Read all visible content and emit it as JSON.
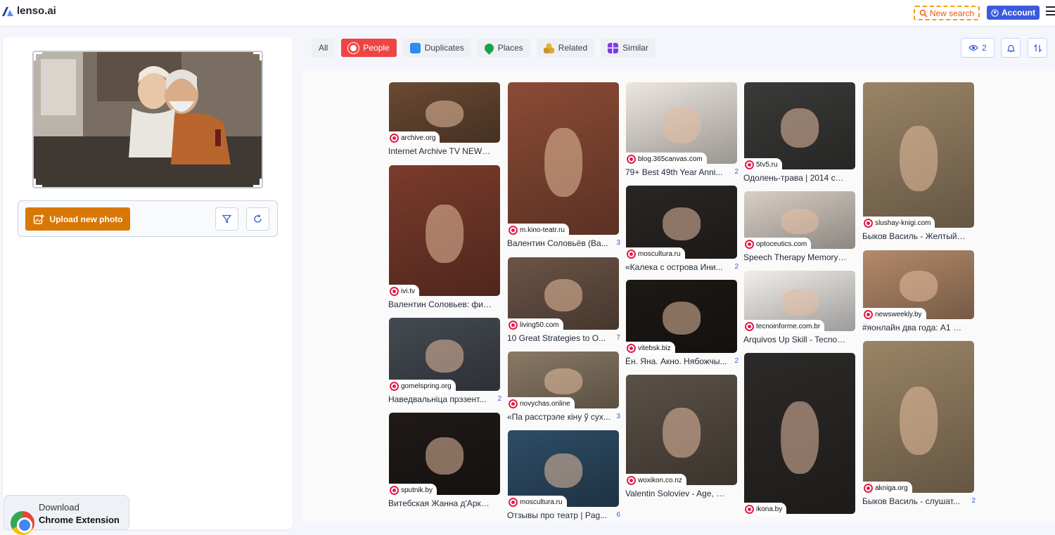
{
  "header": {
    "logo_text": "lenso.ai",
    "new_search": "New search",
    "account": "Account"
  },
  "left": {
    "upload_label": "Upload new photo",
    "extension_line1": "Download",
    "extension_line2": "Chrome Extension"
  },
  "tabs": [
    {
      "label": "All",
      "icon": null
    },
    {
      "label": "People",
      "icon": "people-icon"
    },
    {
      "label": "Duplicates",
      "icon": "duplicates-icon"
    },
    {
      "label": "Places",
      "icon": "places-icon"
    },
    {
      "label": "Related",
      "icon": "related-icon"
    },
    {
      "label": "Similar",
      "icon": "similar-icon"
    }
  ],
  "active_tab": "People",
  "views_count": "2",
  "colors": {
    "accent": "#3b5bdb",
    "people_tab": "#ef4444",
    "upload": "#d97706",
    "new_search_border": "#f59e0b"
  },
  "results": [
    {
      "source": "archive.org",
      "title": "Internet Archive TV NEWS : ...",
      "count": ""
    },
    {
      "source": "ivi.tv",
      "title": "Валентин Соловьев: филь...",
      "count": ""
    },
    {
      "source": "gomelspring.org",
      "title": "Наведвальніца прэзент...",
      "count": "2"
    },
    {
      "source": "sputnik.by",
      "title": "Витебская Жанна д'Арк: к ...",
      "count": ""
    },
    {
      "source": "m.kino-teatr.ru",
      "title": "Валентин Соловьёв (Ва...",
      "count": "3"
    },
    {
      "source": "living50.com",
      "title": "10 Great Strategies to O...",
      "count": "7"
    },
    {
      "source": "novychas.online",
      "title": "«Па расстрэле кіну ў сух...",
      "count": "3"
    },
    {
      "source": "moscultura.ru",
      "title": "Отзывы про театр | Pag...",
      "count": "6"
    },
    {
      "source": "blog.365canvas.com",
      "title": "79+ Best 49th Year Anni...",
      "count": "2"
    },
    {
      "source": "moscultura.ru",
      "title": "«Калека с острова Ини...",
      "count": "2"
    },
    {
      "source": "vitebsk.biz",
      "title": "Ён. Яна. Акно. Нябожчы...",
      "count": "2"
    },
    {
      "source": "woxikon.co.nz",
      "title": "Valentin Soloviev - Age, Bio,...",
      "count": ""
    },
    {
      "source": "5tv5.ru",
      "title": "Одолень-трава | 2014 смо...",
      "count": ""
    },
    {
      "source": "optoceutics.com",
      "title": "Speech Therapy Memory Ac...",
      "count": ""
    },
    {
      "source": "tecnoinforme.com.br",
      "title": "Arquivos Up Skill - TecnoInf...",
      "count": ""
    },
    {
      "source": "ikona.by",
      "title": "",
      "count": ""
    },
    {
      "source": "slushay-knigi.com",
      "title": "Быков Василь - Желтый пе...",
      "count": ""
    },
    {
      "source": "newsweekly.by",
      "title": "#яонлайн два года: A1 пре...",
      "count": ""
    },
    {
      "source": "akniga.org",
      "title": "Быков Василь - слушат...",
      "count": "2"
    }
  ]
}
